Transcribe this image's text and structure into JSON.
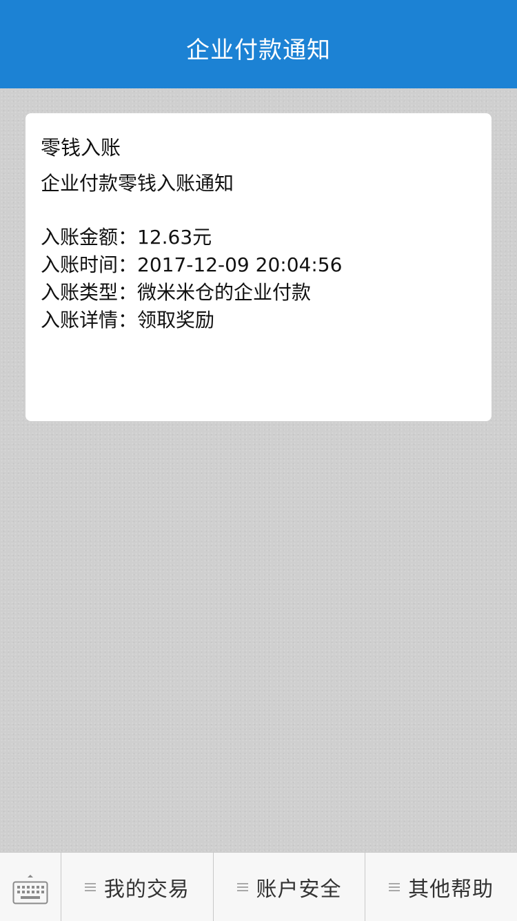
{
  "header": {
    "title": "企业付款通知"
  },
  "card": {
    "title": "零钱入账",
    "subtitle": "企业付款零钱入账通知",
    "details": [
      {
        "label": "入账金额：",
        "value": "12.63元"
      },
      {
        "label": "入账时间：",
        "value": "2017-12-09 20:04:56"
      },
      {
        "label": "入账类型：",
        "value": "微米米仓的企业付款"
      },
      {
        "label": "入账详情：",
        "value": "领取奖励"
      }
    ]
  },
  "bottom_menu": {
    "keyboard_icon": "keyboard-icon",
    "items": [
      {
        "label": "我的交易",
        "icon": "menu-lines-icon"
      },
      {
        "label": "账户安全",
        "icon": "menu-lines-icon"
      },
      {
        "label": "其他帮助",
        "icon": "menu-lines-icon"
      }
    ]
  },
  "colors": {
    "header_bg": "#1c82d4",
    "page_bg": "#cfcfcf",
    "card_bg": "#ffffff",
    "bottom_bar_bg": "#f7f7f7"
  }
}
